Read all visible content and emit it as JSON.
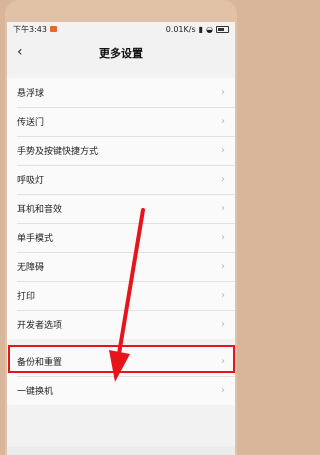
{
  "status": {
    "time": "下午3:43",
    "speed": "0.01K/s",
    "battery": ""
  },
  "header": {
    "title": "更多设置"
  },
  "groups": [
    {
      "items": [
        {
          "label": "悬浮球"
        },
        {
          "label": "传送门"
        },
        {
          "label": "手势及按键快捷方式"
        },
        {
          "label": "呼吸灯"
        },
        {
          "label": "耳机和音效"
        },
        {
          "label": "单手模式"
        },
        {
          "label": "无障碍"
        },
        {
          "label": "打印"
        },
        {
          "label": "开发者选项"
        }
      ]
    },
    {
      "items": [
        {
          "label": "备份和重置"
        },
        {
          "label": "一键换机"
        }
      ]
    }
  ],
  "colors": {
    "highlight": "#e8141b",
    "arrow": "#e8141b"
  }
}
